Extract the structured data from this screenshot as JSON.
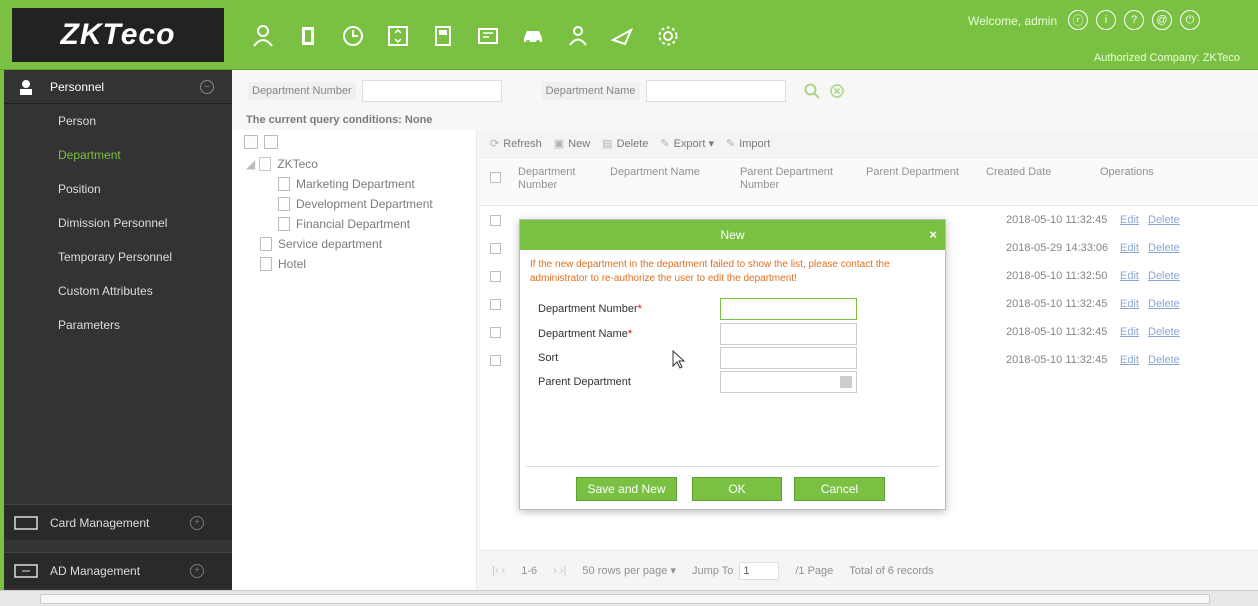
{
  "brand": "ZKTeco",
  "header": {
    "welcome": "Welcome, admin",
    "company": "Authorized Company: ZKTeco",
    "modules": [
      "personnel-icon",
      "access-icon",
      "time-icon",
      "elevator-icon",
      "visitor-icon",
      "parking-icon",
      "car-icon",
      "patrol-icon",
      "ad-icon",
      "system-icon"
    ],
    "top_icons": [
      "user-icon",
      "info-icon",
      "help-icon",
      "account-icon",
      "power-icon"
    ]
  },
  "sidebar": {
    "section": "Personnel",
    "items": [
      {
        "label": "Person"
      },
      {
        "label": "Department",
        "active": true
      },
      {
        "label": "Position"
      },
      {
        "label": "Dimission Personnel"
      },
      {
        "label": "Temporary Personnel"
      },
      {
        "label": "Custom Attributes"
      },
      {
        "label": "Parameters"
      }
    ],
    "bottom": [
      {
        "label": "Card Management"
      },
      {
        "label": "AD Management"
      }
    ]
  },
  "query": {
    "dept_number_label": "Department Number",
    "dept_name_label": "Department Name",
    "conditions": "The current query conditions: None"
  },
  "tree": {
    "root": "ZKTeco",
    "children": [
      "Marketing Department",
      "Development Department",
      "Financial Department"
    ],
    "siblings": [
      "Service department",
      "Hotel"
    ]
  },
  "toolbar": {
    "refresh": "Refresh",
    "new": "New",
    "delete": "Delete",
    "export": "Export",
    "import": "Import"
  },
  "grid": {
    "columns": [
      "Department Number",
      "Department Name",
      "Parent Department Number",
      "Parent Department",
      "Created Date",
      "Operations"
    ],
    "rows": [
      {
        "date": "2018-05-10 11:32:45",
        "edit": "Edit",
        "del": "Delete"
      },
      {
        "date": "2018-05-29 14:33:06",
        "edit": "Edit",
        "del": "Delete"
      },
      {
        "date": "2018-05-10 11:32:50",
        "edit": "Edit",
        "del": "Delete"
      },
      {
        "date": "2018-05-10 11:32:45",
        "edit": "Edit",
        "del": "Delete"
      },
      {
        "date": "2018-05-10 11:32:45",
        "edit": "Edit",
        "del": "Delete"
      },
      {
        "date": "2018-05-10 11:32:45",
        "edit": "Edit",
        "del": "Delete"
      }
    ]
  },
  "pager": {
    "range": "1-6",
    "per_page": "50 rows per page",
    "jump_label": "Jump To",
    "jump_value": "1",
    "pages": "/1 Page",
    "total": "Total of 6 records"
  },
  "modal": {
    "title": "New",
    "warning": "If the new department in the department failed to show the list, please contact the administrator to re-authorize the user to edit the department!",
    "fields": {
      "number": "Department Number",
      "name": "Department Name",
      "sort": "Sort",
      "parent": "Parent Department"
    },
    "buttons": {
      "save_new": "Save and New",
      "ok": "OK",
      "cancel": "Cancel"
    }
  },
  "colors": {
    "accent": "#7ac143",
    "sidebar": "#333333",
    "warning": "#e07020",
    "link": "#4a77b4"
  }
}
